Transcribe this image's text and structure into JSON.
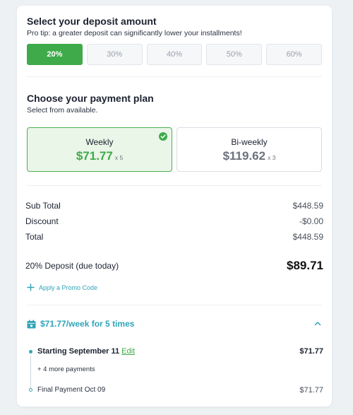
{
  "deposit": {
    "title": "Select your deposit amount",
    "tip": "Pro tip: a greater deposit can significantly lower your installments!",
    "options": [
      "20%",
      "30%",
      "40%",
      "50%",
      "60%"
    ],
    "selected": "20%"
  },
  "plan": {
    "title": "Choose your payment plan",
    "subtitle": "Select from available.",
    "options": [
      {
        "name": "Weekly",
        "price": "$71.77",
        "times": "x 5",
        "selected": true
      },
      {
        "name": "Bi-weekly",
        "price": "$119.62",
        "times": "x 3",
        "selected": false
      }
    ]
  },
  "summary": {
    "subtotal_label": "Sub Total",
    "subtotal_value": "$448.59",
    "discount_label": "Discount",
    "discount_value": "-$0.00",
    "total_label": "Total",
    "total_value": "$448.59",
    "deposit_label": "20% Deposit (due today)",
    "deposit_value": "$89.71"
  },
  "promo": {
    "label": "Apply a Promo Code"
  },
  "schedule": {
    "title": "$71.77/week for 5 times",
    "start_label": "Starting September 11",
    "edit_label": "Edit",
    "start_amount": "$71.77",
    "more_label": "+ 4 more payments",
    "final_label": "Final Payment Oct 09",
    "final_amount": "$71.77"
  },
  "colors": {
    "accent_green": "#3faa4a",
    "accent_teal": "#2fa4b8"
  },
  "icons": {
    "selected_plan": "check-circle-icon",
    "promo": "plus-icon",
    "schedule": "calendar-icon",
    "collapse": "chevron-up-icon"
  }
}
